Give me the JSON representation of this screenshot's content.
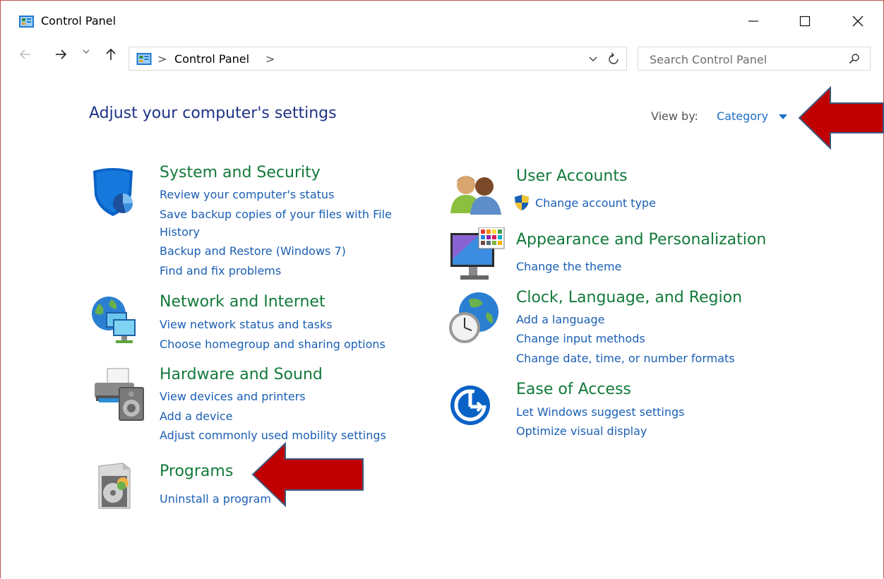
{
  "window": {
    "title": "Control Panel",
    "minimize_glyph": "—",
    "maximize_glyph": "☐",
    "close_glyph": "✕"
  },
  "address": {
    "crumb": "Control Panel",
    "separator": ">",
    "search_placeholder": "Search Control Panel"
  },
  "main": {
    "heading": "Adjust your computer's settings",
    "view_by_label": "View by:",
    "view_by_value": "Category"
  },
  "categories": {
    "system": {
      "title": "System and Security",
      "links": [
        "Review your computer's status",
        "Save backup copies of your files with File",
        "History",
        "Backup and Restore (Windows 7)",
        "Find and fix problems"
      ]
    },
    "network": {
      "title": "Network and Internet",
      "links": [
        "View network status and tasks",
        "Choose homegroup and sharing options"
      ]
    },
    "hardware": {
      "title": "Hardware and Sound",
      "links": [
        "View devices and printers",
        "Add a device",
        "Adjust commonly used mobility settings"
      ]
    },
    "programs": {
      "title": "Programs",
      "links": [
        "Uninstall a program"
      ]
    },
    "users": {
      "title": "User Accounts",
      "links": [
        "Change account type"
      ]
    },
    "appearance": {
      "title": "Appearance and Personalization",
      "links": [
        "Change the theme"
      ]
    },
    "clock": {
      "title": "Clock, Language, and Region",
      "links": [
        "Add a language",
        "Change input methods",
        "Change date, time, or number formats"
      ]
    },
    "ease": {
      "title": "Ease of Access",
      "links": [
        "Let Windows suggest settings",
        "Optimize visual display"
      ]
    }
  },
  "colors": {
    "category_title": "#127a3a",
    "link": "#1a5fb4",
    "heading": "#1e3287",
    "annotation_arrow": "#c00000"
  },
  "icons": {
    "system": "shield-icon",
    "network": "network-globe-icon",
    "hardware": "printer-speaker-icon",
    "programs": "programs-disc-icon",
    "users": "user-accounts-icon",
    "appearance": "monitor-palette-icon",
    "clock": "globe-clock-icon",
    "ease": "ease-of-access-icon",
    "uac": "uac-shield-icon"
  }
}
